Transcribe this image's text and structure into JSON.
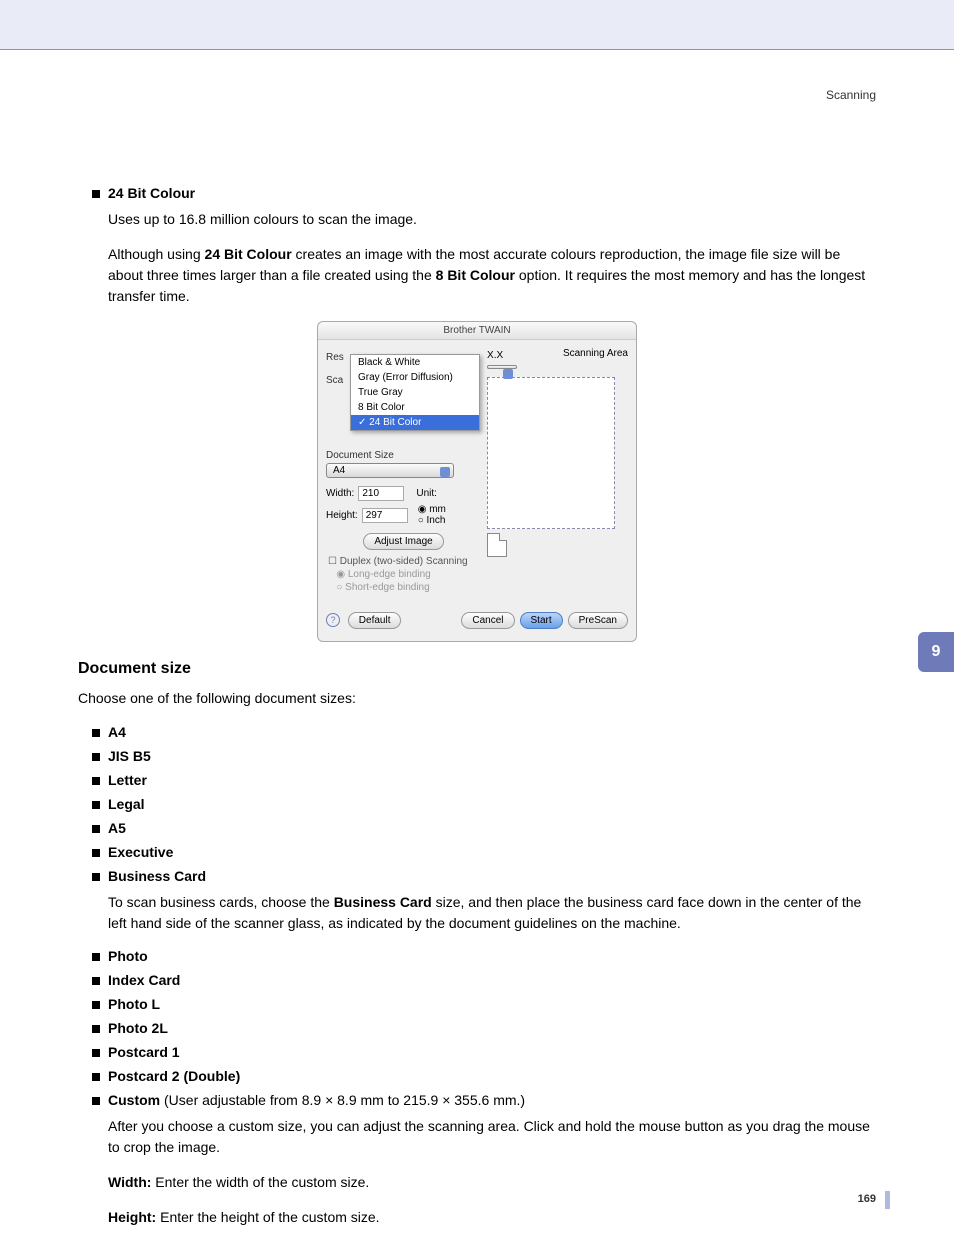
{
  "header": {
    "section": "Scanning"
  },
  "twentyFourBit": {
    "title": "24 Bit Colour",
    "desc": "Uses up to 16.8 million colours to scan the image.",
    "para_prefix": "Although using ",
    "bold1": "24 Bit Colour",
    "para_mid": " creates an image with the most accurate colours reproduction, the image file size will be about three times larger than a file created using the ",
    "bold2": "8 Bit Colour",
    "para_suffix": " option. It requires the most memory and has the longest transfer time."
  },
  "twain": {
    "title": "Brother TWAIN",
    "version": "X.X",
    "resLabel": "Res",
    "scanTypeLabel": "Sca",
    "menu": {
      "bw": "Black & White",
      "gray": "Gray (Error Diffusion)",
      "trueGray": "True Gray",
      "eightBit": "8 Bit Color",
      "selected": "24 Bit Color"
    },
    "docSize": "Document Size",
    "docSizeVal": "A4",
    "widthLbl": "Width:",
    "widthVal": "210",
    "heightLbl": "Height:",
    "heightVal": "297",
    "unitLbl": "Unit:",
    "unitMm": "mm",
    "unitInch": "Inch",
    "adjust": "Adjust Image",
    "duplex": "Duplex (two-sided) Scanning",
    "longEdge": "Long-edge binding",
    "shortEdge": "Short-edge binding",
    "scanArea": "Scanning Area",
    "default": "Default",
    "cancel": "Cancel",
    "start": "Start",
    "prescan": "PreScan",
    "help": "?"
  },
  "docSizeSection": {
    "heading": "Document size",
    "intro": "Choose one of the following document sizes:",
    "items": [
      "A4",
      "JIS B5",
      "Letter",
      "Legal",
      "A5",
      "Executive",
      "Business Card"
    ],
    "businessCardPara_pre": "To scan business cards, choose the ",
    "businessCardBold": "Business Card",
    "businessCardPara_post": " size, and then place the business card face down in the center of the left hand side of the scanner glass, as indicated by the document guidelines on the machine.",
    "items2": [
      "Photo",
      "Index Card",
      "Photo L",
      "Photo 2L",
      "Postcard 1",
      "Postcard 2 (Double)"
    ],
    "customBold": "Custom",
    "customText": " (User adjustable from 8.9 × 8.9 mm to 215.9 × 355.6 mm.)",
    "customPara": "After you choose a custom size, you can adjust the scanning area. Click and hold the mouse button as you drag the mouse to crop the image.",
    "widthBold": "Width:",
    "widthText": " Enter the width of the custom size.",
    "heightBold": "Height:",
    "heightText": " Enter the height of the custom size."
  },
  "sideTab": "9",
  "pageNumber": "169"
}
